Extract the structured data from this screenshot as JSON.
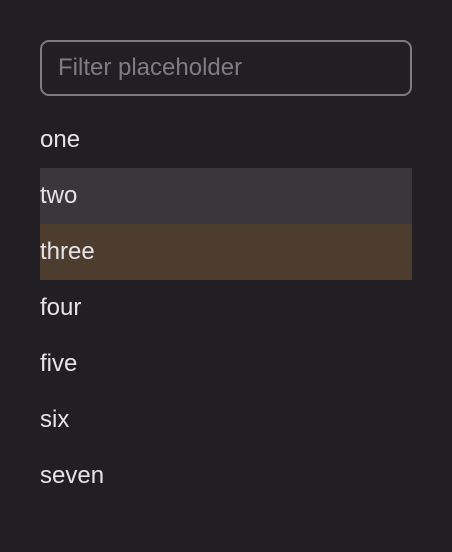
{
  "filter": {
    "placeholder": "Filter placeholder",
    "value": ""
  },
  "list": {
    "items": [
      {
        "label": "one",
        "state": "normal"
      },
      {
        "label": "two",
        "state": "hover"
      },
      {
        "label": "three",
        "state": "selected"
      },
      {
        "label": "four",
        "state": "normal"
      },
      {
        "label": "five",
        "state": "normal"
      },
      {
        "label": "six",
        "state": "normal"
      },
      {
        "label": "seven",
        "state": "normal"
      }
    ]
  },
  "colors": {
    "background": "#221f24",
    "text": "#e6e3e8",
    "border": "#7d7a80",
    "hover": "#39363c",
    "selected": "#4c3d2f"
  }
}
